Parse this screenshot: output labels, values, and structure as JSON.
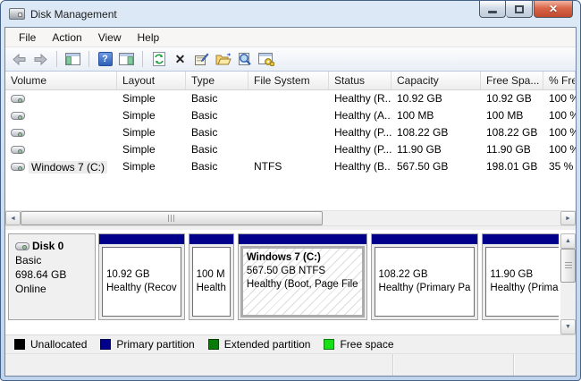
{
  "window": {
    "title": "Disk Management",
    "controls": {
      "close_glyph": "✕"
    }
  },
  "menu": {
    "items": [
      "File",
      "Action",
      "View",
      "Help"
    ]
  },
  "toolbar": {
    "icons": [
      {
        "name": "back"
      },
      {
        "name": "forward"
      },
      {
        "name": "show-console-tree"
      },
      {
        "name": "help",
        "glyph": "?"
      },
      {
        "name": "show-action-pane"
      },
      {
        "name": "refresh"
      },
      {
        "name": "delete",
        "glyph": "✕"
      },
      {
        "name": "properties"
      },
      {
        "name": "open-folder"
      },
      {
        "name": "find"
      },
      {
        "name": "console-settings"
      }
    ]
  },
  "volume_list": {
    "columns": [
      "Volume",
      "Layout",
      "Type",
      "File System",
      "Status",
      "Capacity",
      "Free Spa...",
      "% Fre"
    ],
    "rows": [
      {
        "name": "",
        "layout": "Simple",
        "type": "Basic",
        "fs": "",
        "status": "Healthy (R...",
        "capacity": "10.92 GB",
        "free": "10.92 GB",
        "pct": "100 %"
      },
      {
        "name": "",
        "layout": "Simple",
        "type": "Basic",
        "fs": "",
        "status": "Healthy (A...",
        "capacity": "100 MB",
        "free": "100 MB",
        "pct": "100 %"
      },
      {
        "name": "",
        "layout": "Simple",
        "type": "Basic",
        "fs": "",
        "status": "Healthy (P...",
        "capacity": "108.22 GB",
        "free": "108.22 GB",
        "pct": "100 %"
      },
      {
        "name": "",
        "layout": "Simple",
        "type": "Basic",
        "fs": "",
        "status": "Healthy (P...",
        "capacity": "11.90 GB",
        "free": "11.90 GB",
        "pct": "100 %"
      },
      {
        "name": "Windows 7 (C:)",
        "layout": "Simple",
        "type": "Basic",
        "fs": "NTFS",
        "status": "Healthy (B...",
        "capacity": "567.50 GB",
        "free": "198.01 GB",
        "pct": "35 %"
      }
    ]
  },
  "disk": {
    "label": "Disk 0",
    "type": "Basic",
    "capacity": "698.64 GB",
    "status": "Online",
    "partitions": [
      {
        "title": "",
        "line1": "10.92 GB",
        "line2": "Healthy (Recov"
      },
      {
        "title": "",
        "line1": "100 M",
        "line2": "Health"
      },
      {
        "title": "Windows 7  (C:)",
        "line1": "567.50 GB NTFS",
        "line2": "Healthy (Boot, Page File"
      },
      {
        "title": "",
        "line1": "108.22 GB",
        "line2": "Healthy (Primary Pa"
      },
      {
        "title": "",
        "line1": "11.90 GB",
        "line2": "Healthy (Primary"
      }
    ]
  },
  "legend": {
    "items": [
      {
        "label": "Unallocated",
        "color": "#000000"
      },
      {
        "label": "Primary partition",
        "color": "#00008b"
      },
      {
        "label": "Extended partition",
        "color": "#0a7a0a"
      },
      {
        "label": "Free space",
        "color": "#16e116"
      }
    ]
  },
  "colors": {
    "primary_partition_band": "#00008b",
    "titlebar_top": "#dde9f6",
    "close_button": "#c04a2e"
  },
  "scrollbars": {
    "left_glyph": "◄",
    "right_glyph": "►",
    "up_glyph": "▲",
    "down_glyph": "▼"
  }
}
